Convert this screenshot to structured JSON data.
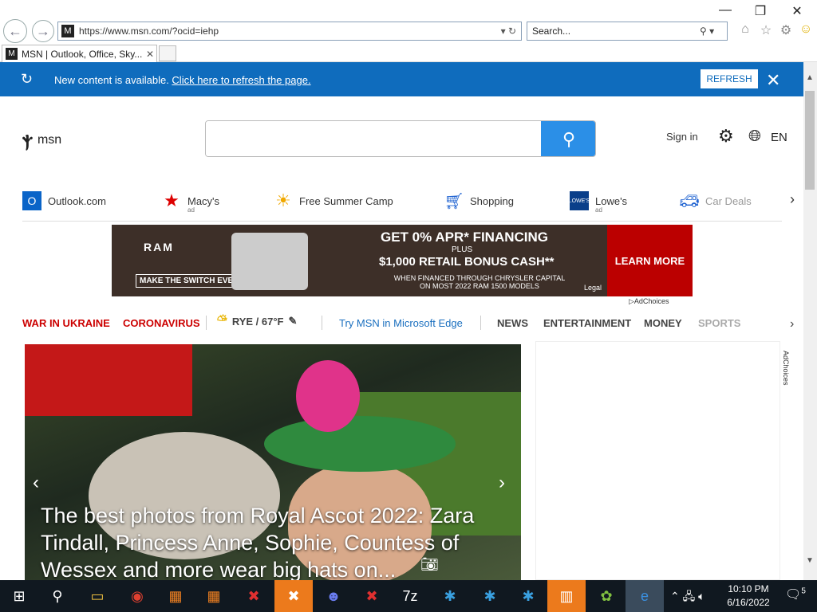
{
  "browser": {
    "url": "https://www.msn.com/?ocid=iehp",
    "search_placeholder": "Search...",
    "tab_title": "MSN | Outlook, Office, Sky...",
    "window_controls": {
      "minimize": "—",
      "restore": "❐",
      "close": "✕"
    }
  },
  "notice": {
    "message": "New content is available. ",
    "link": "Click here to refresh the page.",
    "button": "REFRESH"
  },
  "msn": {
    "logo": "msn",
    "signin": "Sign in",
    "lang": "EN"
  },
  "quicklinks": [
    {
      "label": "Outlook.com",
      "ad": ""
    },
    {
      "label": "Macy's",
      "ad": "ad"
    },
    {
      "label": "Free Summer Camp",
      "ad": ""
    },
    {
      "label": "Shopping",
      "ad": ""
    },
    {
      "label": "Lowe's",
      "ad": "ad"
    },
    {
      "label": "Car Deals",
      "ad": ""
    }
  ],
  "ad": {
    "brand": "RAM",
    "switch": "MAKE THE SWITCH EVENT",
    "headline": "GET 0% APR* FINANCING",
    "plus": "PLUS",
    "bonus": "$1,000 RETAIL BONUS CASH**",
    "fine": "WHEN FINANCED THROUGH CHRYSLER CAPITAL ON MOST 2022 RAM 1500 MODELS",
    "cta": "LEARN MORE",
    "legal": "Legal",
    "adchoices": "AdChoices"
  },
  "topics": {
    "war": "WAR IN UKRAINE",
    "corona": "CORONAVIRUS",
    "weather": "RYE / 67°F",
    "edge": "Try MSN in Microsoft Edge",
    "news": "NEWS",
    "ent": "ENTERTAINMENT",
    "money": "MONEY",
    "sports": "SPORTS"
  },
  "hero": {
    "caption": "The best photos from Royal Ascot 2022: Zara Tindall, Princess Anne, Sophie, Countess of Wessex and more wear big hats on..."
  },
  "sidebar": {
    "adchoices": "AdChoices"
  },
  "taskbar": {
    "time": "10:10 PM",
    "date": "6/16/2022",
    "notifications": "5"
  }
}
